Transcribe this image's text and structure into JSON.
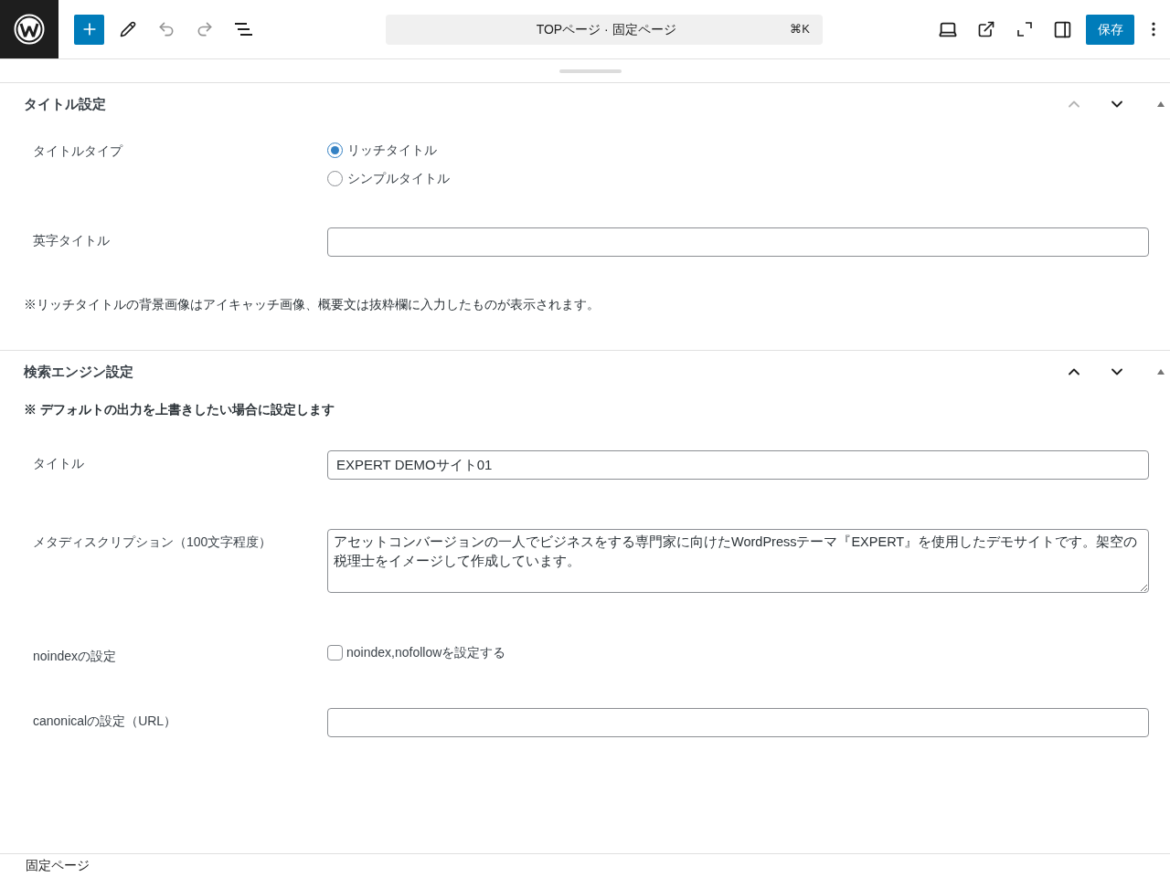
{
  "toolbar": {
    "command": {
      "title": "TOPページ · 固定ページ",
      "shortcut": "⌘K"
    },
    "undo_disabled": true,
    "redo_disabled": true,
    "save_label": "保存"
  },
  "panels": [
    {
      "title": "タイトル設定",
      "move_up_disabled": true,
      "move_down_disabled": false,
      "items": [
        {
          "kind": "field",
          "label": "タイトルタイプ",
          "control": {
            "kind": "radio",
            "options": [
              {
                "label": "リッチタイトル",
                "selected": true
              },
              {
                "label": "シンプルタイトル",
                "selected": false
              }
            ]
          }
        },
        {
          "kind": "field",
          "label": "英字タイトル",
          "control": {
            "kind": "text"
          }
        },
        {
          "kind": "note",
          "text": "※リッチタイトルの背景画像はアイキャッチ画像、概要文は抜粋欄に入力したものが表示されます。",
          "emphasis": false
        }
      ]
    },
    {
      "title": "検索エンジン設定",
      "move_up_disabled": false,
      "move_down_disabled": false,
      "items": [
        {
          "kind": "note",
          "text": "※ デフォルトの出力を上書きしたい場合に設定します",
          "emphasis": true
        },
        {
          "kind": "field",
          "label": "タイトル",
          "control": {
            "kind": "text",
            "value": "EXPERT DEMOサイト01"
          }
        },
        {
          "kind": "field",
          "label": "メタディスクリプション（100文字程度）",
          "control": {
            "kind": "textarea",
            "value": "アセットコンバージョンの一人でビジネスをする専門家に向けたWordPressテーマ『EXPERT』を使用したデモサイトです。架空の税理士をイメージして作成しています。"
          }
        },
        {
          "kind": "field",
          "label": "noindexの設定",
          "control": {
            "kind": "checkbox",
            "label": "noindex,nofollowを設定する",
            "checked": false
          }
        },
        {
          "kind": "field",
          "label": "canonicalの設定（URL）",
          "control": {
            "kind": "text"
          }
        }
      ]
    }
  ],
  "footer": {
    "breadcrumb": "固定ページ"
  }
}
